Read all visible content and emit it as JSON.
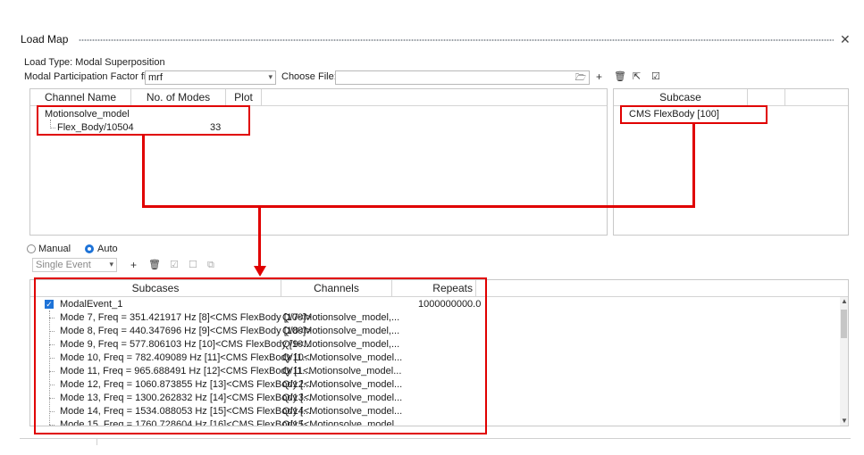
{
  "window": {
    "title": "Load Map",
    "close_glyph": "✕"
  },
  "load_type": "Load Type: Modal Superposition",
  "mpf": {
    "label": "Modal Participation Factor file:",
    "value": "mrf",
    "choose_label": "Choose File:",
    "choose_value": ""
  },
  "top_tools": [
    "+",
    "🗑",
    "⇱",
    "☑"
  ],
  "channel_table": {
    "columns": [
      "Channel Name",
      "No. of Modes",
      "Plot"
    ],
    "root": "Motionsolve_model",
    "child": {
      "name": "Flex_Body/10504",
      "modes": "33"
    }
  },
  "subcase_table": {
    "column": "Subcase",
    "item": "CMS FlexBody [100]"
  },
  "mode": {
    "manual": "Manual",
    "auto": "Auto",
    "selected": "Auto"
  },
  "event_select": "Single Event",
  "bottom_tools": [
    "+",
    "🗑",
    "☑",
    "☐",
    "⧉"
  ],
  "events_table": {
    "columns": [
      "Subcases",
      "Channels",
      "Repeats"
    ],
    "event": {
      "name": "ModalEvent_1",
      "repeats": "1000000000.0"
    },
    "rows": [
      {
        "subcase": "Mode 7, Freq = 351.421917 Hz [8]<CMS FlexBody [100]>",
        "channel": "Q/7<Motionsolve_model,..."
      },
      {
        "subcase": "Mode 8, Freq = 440.347696 Hz [9]<CMS FlexBody [100]>",
        "channel": "Q/8<Motionsolve_model,..."
      },
      {
        "subcase": "Mode 9, Freq = 577.806103 Hz [10]<CMS FlexBody [10...",
        "channel": "Q/9<Motionsolve_model,..."
      },
      {
        "subcase": "Mode 10, Freq = 782.409089 Hz [11]<CMS FlexBody [1...",
        "channel": "Q/10<Motionsolve_model..."
      },
      {
        "subcase": "Mode 11, Freq = 965.688491 Hz [12]<CMS FlexBody [1...",
        "channel": "Q/11<Motionsolve_model..."
      },
      {
        "subcase": "Mode 12, Freq = 1060.873855 Hz [13]<CMS FlexBody [...",
        "channel": "Q/12<Motionsolve_model..."
      },
      {
        "subcase": "Mode 13, Freq = 1300.262832 Hz [14]<CMS FlexBody [...",
        "channel": "Q/13<Motionsolve_model..."
      },
      {
        "subcase": "Mode 14, Freq = 1534.088053 Hz [15]<CMS FlexBody [...",
        "channel": "Q/14<Motionsolve_model..."
      },
      {
        "subcase": "Mode 15, Freq = 1760.728604 Hz [16]<CMS FlexBody [...",
        "channel": "Q/15<Motionsolve_model..."
      }
    ]
  },
  "colors": {
    "annotation": "#e00000",
    "accent": "#1e73d8"
  }
}
